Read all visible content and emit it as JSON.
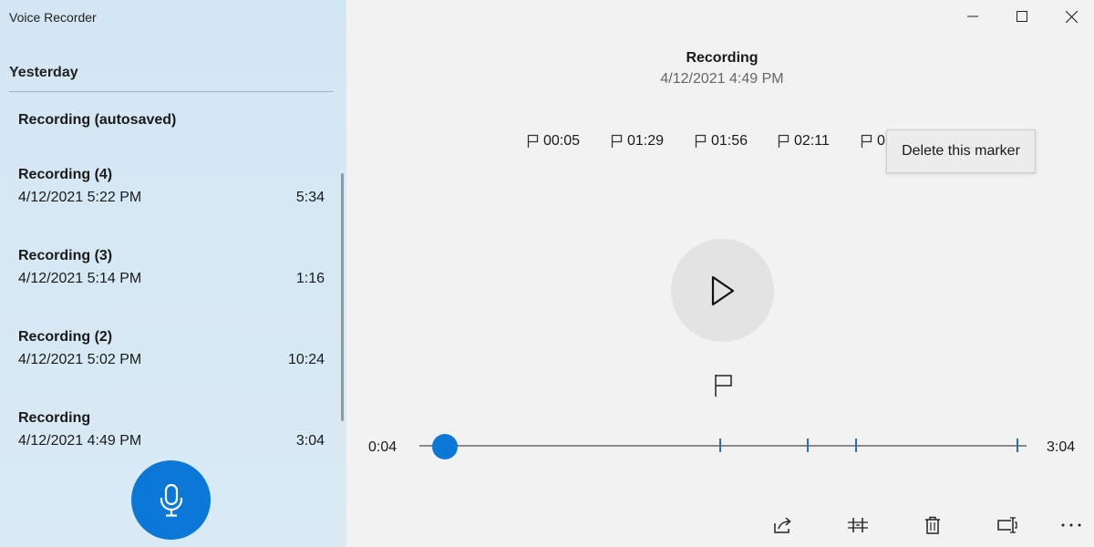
{
  "app": {
    "title": "Voice Recorder"
  },
  "sidebar": {
    "section_header": "Yesterday",
    "recordings": [
      {
        "name": "Recording (autosaved)",
        "date": "",
        "duration": ""
      },
      {
        "name": "Recording (4)",
        "date": "4/12/2021 5:22 PM",
        "duration": "5:34"
      },
      {
        "name": "Recording (3)",
        "date": "4/12/2021 5:14 PM",
        "duration": "1:16"
      },
      {
        "name": "Recording (2)",
        "date": "4/12/2021 5:02 PM",
        "duration": "10:24"
      },
      {
        "name": "Recording",
        "date": "4/12/2021 4:49 PM",
        "duration": "3:04"
      }
    ],
    "record_button_icon": "microphone-icon"
  },
  "main": {
    "title": "Recording",
    "subtitle": "4/12/2021 4:49 PM",
    "markers": [
      "00:05",
      "01:29",
      "01:56",
      "02:11",
      "0"
    ],
    "tooltip": "Delete this marker",
    "playback": {
      "current_time": "0:04",
      "total_time": "3:04",
      "position_seconds": 4,
      "total_seconds": 184,
      "marker_seconds": [
        89,
        116,
        131,
        181
      ]
    },
    "toolbar": [
      "share-icon",
      "trim-icon",
      "delete-icon",
      "rename-icon",
      "more-icon"
    ]
  },
  "window_controls": [
    "minimize-icon",
    "maximize-icon",
    "close-icon"
  ],
  "colors": {
    "accent": "#0b78d7",
    "sidebar_bg": "#d6e8f4",
    "main_bg": "#f2f2f2"
  }
}
